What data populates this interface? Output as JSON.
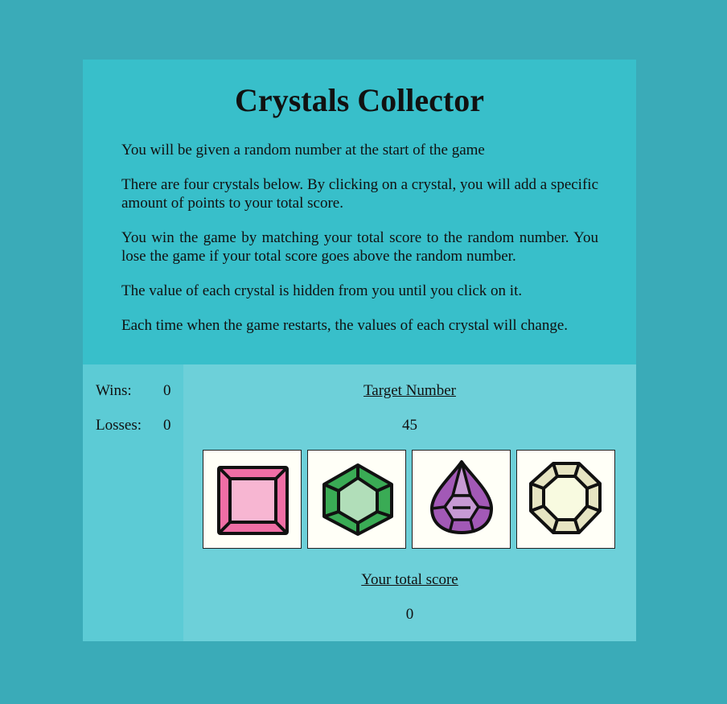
{
  "title": "Crystals Collector",
  "instructions": [
    "You will be given a random number at the start of the game",
    "There are four crystals below. By clicking on a crystal, you will add a specific amount of points to your total score.",
    "You win the game by matching your total score to the random number. You lose the game if your total score goes above the random number.",
    "The value of each crystal is hidden from you until you click on it.",
    "Each time when the game restarts, the values of each crystal will change."
  ],
  "stats": {
    "wins_label": "Wins:",
    "wins_value": "0",
    "losses_label": "Losses:",
    "losses_value": "0"
  },
  "target": {
    "label": "Target Number",
    "value": "45"
  },
  "score": {
    "label": "Your total score",
    "value": "0"
  },
  "crystals": [
    {
      "name": "pink-square-crystal",
      "color": "#f06fa6"
    },
    {
      "name": "green-hexagon-crystal",
      "color": "#3fae5a"
    },
    {
      "name": "purple-teardrop-crystal",
      "color": "#a45cb8"
    },
    {
      "name": "cream-octagon-crystal",
      "color": "#e8e6c4"
    }
  ]
}
